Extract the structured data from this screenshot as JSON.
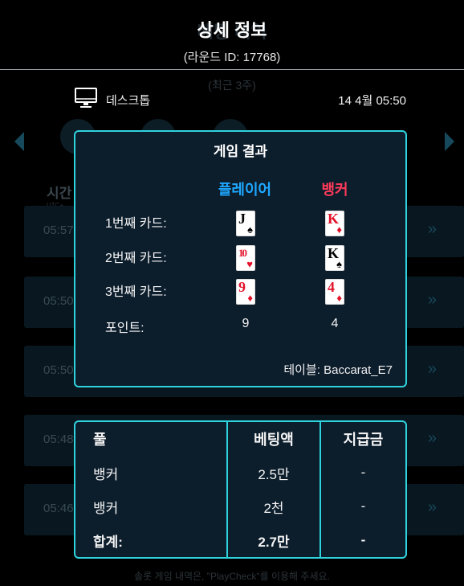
{
  "header": {
    "title": "상세 정보",
    "round_id": "(라운드 ID: 17768)"
  },
  "background": {
    "subtitle": "(최근 3주)",
    "column_head": "시간",
    "column_sub": "UTC+",
    "rows": [
      "05:57",
      "05:50",
      "05:50",
      "05:48",
      "05:46"
    ],
    "footer_note": "솔롯 게임 내역은, \"PlayCheck\"를 이용해 주세요."
  },
  "device": {
    "icon": "desktop-icon",
    "label": "데스크톱",
    "datetime": "14  4월 05:50"
  },
  "game_result": {
    "title": "게임 결과",
    "player_label": "플레이어",
    "banker_label": "뱅커",
    "player_color": "#1ea7ff",
    "banker_color": "#ff3b5a",
    "rows": [
      {
        "label": "1번째 카드:",
        "player_card": {
          "rank": "J",
          "suit": "♠",
          "color": "black"
        },
        "banker_card": {
          "rank": "K",
          "suit": "♦",
          "color": "red"
        }
      },
      {
        "label": "2번째 카드:",
        "player_card": {
          "rank": "10",
          "suit": "♥",
          "color": "red"
        },
        "banker_card": {
          "rank": "K",
          "suit": "♠",
          "color": "black"
        }
      },
      {
        "label": "3번째 카드:",
        "player_card": {
          "rank": "9",
          "suit": "♦",
          "color": "red"
        },
        "banker_card": {
          "rank": "4",
          "suit": "♦",
          "color": "red"
        }
      }
    ],
    "points_label": "포인트:",
    "player_points": "9",
    "banker_points": "4",
    "table_name": "테이블: Baccarat_E7"
  },
  "bets": {
    "headers": {
      "pool": "풀",
      "amount": "베팅액",
      "payout": "지급금"
    },
    "rows": [
      {
        "pool": "뱅커",
        "amount": "2.5만",
        "payout": "-"
      },
      {
        "pool": "뱅커",
        "amount": "2천",
        "payout": "-"
      }
    ],
    "total": {
      "pool": "합계:",
      "amount": "2.7만",
      "payout": "-"
    }
  },
  "accent_color": "#2fd3de"
}
